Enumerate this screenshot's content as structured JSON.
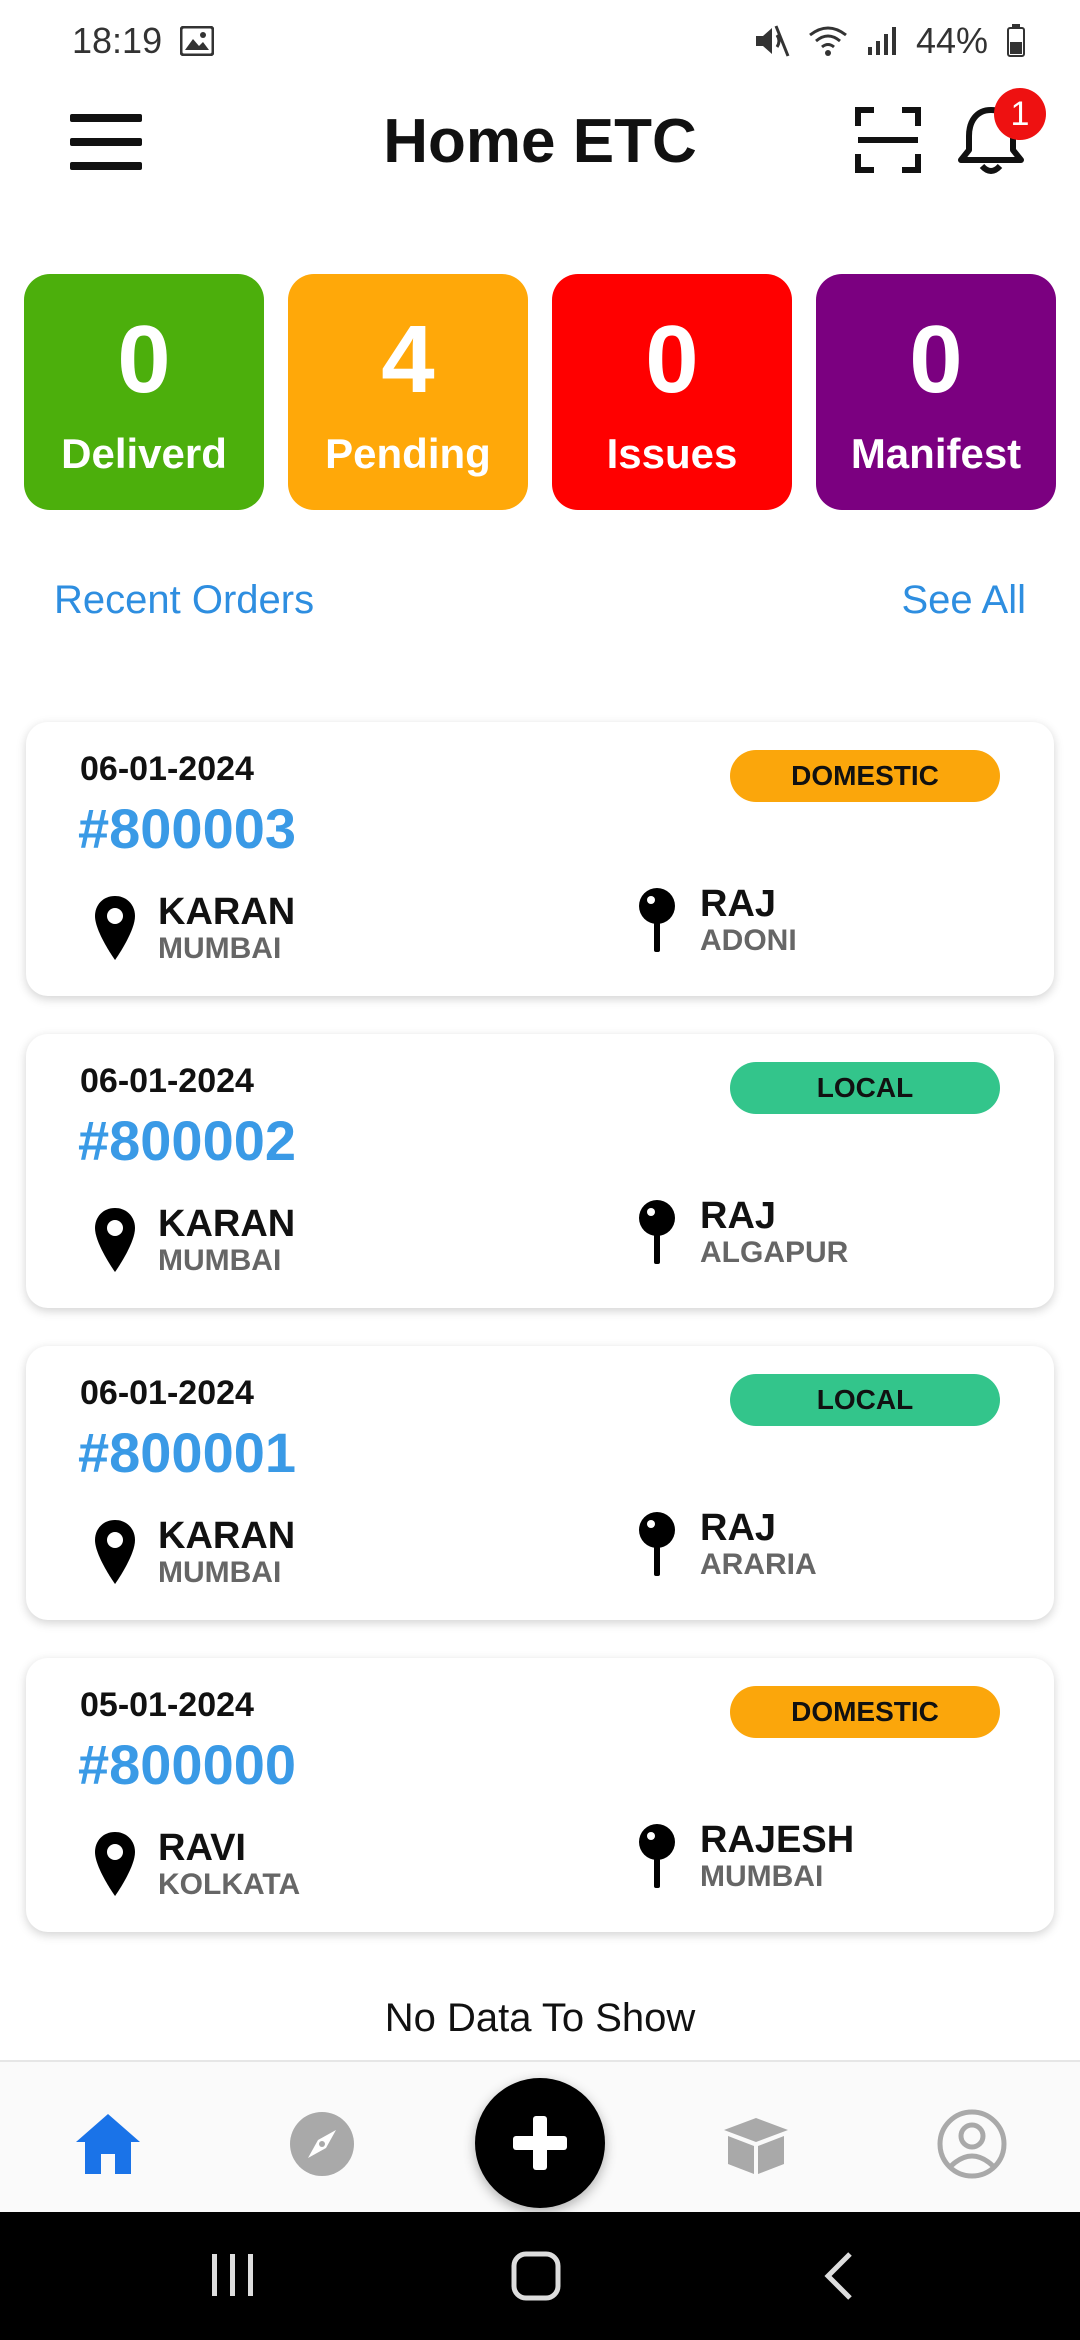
{
  "status_bar": {
    "time": "18:19",
    "battery": "44%"
  },
  "app_bar": {
    "title": "Home ETC",
    "notification_count": "1"
  },
  "stats": [
    {
      "value": "0",
      "label": "Deliverd",
      "color": "#4caf0c"
    },
    {
      "value": "4",
      "label": "Pending",
      "color": "#ffa809"
    },
    {
      "value": "0",
      "label": "Issues",
      "color": "#ff0000"
    },
    {
      "value": "0",
      "label": "Manifest",
      "color": "#7b0080"
    }
  ],
  "recent_orders": {
    "title": "Recent Orders",
    "see_all": "See All",
    "orders": [
      {
        "date": "06-01-2024",
        "id": "#800003",
        "type": "DOMESTIC",
        "from_name": "KARAN",
        "from_city": "MUMBAI",
        "to_name": "RAJ",
        "to_city": "ADONI"
      },
      {
        "date": "06-01-2024",
        "id": "#800002",
        "type": "LOCAL",
        "from_name": "KARAN",
        "from_city": "MUMBAI",
        "to_name": "RAJ",
        "to_city": "ALGAPUR"
      },
      {
        "date": "06-01-2024",
        "id": "#800001",
        "type": "LOCAL",
        "from_name": "KARAN",
        "from_city": "MUMBAI",
        "to_name": "RAJ",
        "to_city": "ARARIA"
      },
      {
        "date": "05-01-2024",
        "id": "#800000",
        "type": "DOMESTIC",
        "from_name": "RAVI",
        "from_city": "KOLKATA",
        "to_name": "RAJESH",
        "to_city": "MUMBAI"
      }
    ],
    "empty_message": "No Data To Show"
  },
  "bottom_nav": {
    "items": [
      "home-icon",
      "compass-icon",
      "add-icon",
      "box-icon",
      "profile-icon"
    ],
    "active_color": "#1a73e8"
  }
}
